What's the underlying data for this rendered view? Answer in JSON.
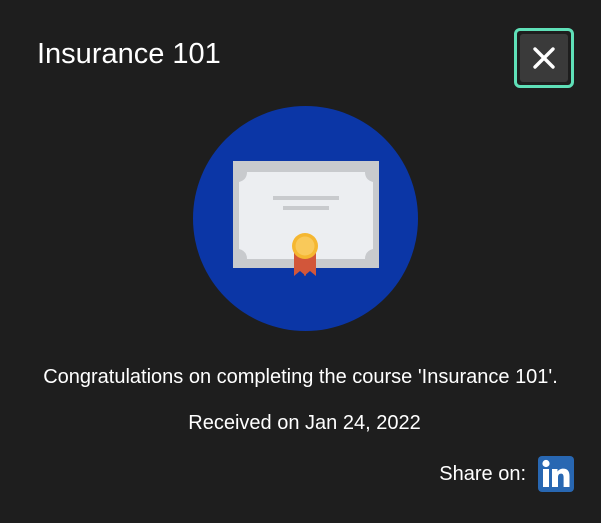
{
  "dialog": {
    "title": "Insurance 101",
    "close_icon": "close-icon",
    "message": "Congratulations on completing the course 'Insurance 101'.",
    "received": "Received on Jan 24, 2022",
    "share_label": "Share on:",
    "share_icon": "linkedin-icon",
    "linkedin_text": "in"
  },
  "colors": {
    "background": "#1e1e1e",
    "close_focus_ring": "#5fe0b8",
    "close_fill": "#3a3a3a",
    "hero_circle": "#0b36a6",
    "certificate_paper": "#eceef1",
    "certificate_border": "#c8cacd",
    "seal_gold": "#f5b731",
    "ribbon_red": "#d2563a",
    "linkedin_blue": "#2867b2"
  }
}
